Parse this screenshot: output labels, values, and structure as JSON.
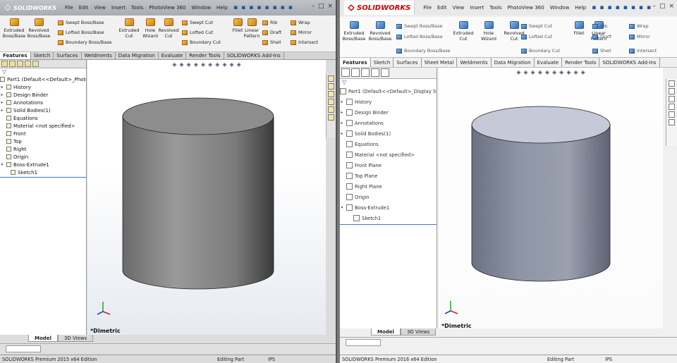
{
  "windows": [
    {
      "id": "w1",
      "logo": "SOLIDWORKS",
      "menu": [
        "File",
        "Edit",
        "View",
        "Insert",
        "Tools",
        "PhotoView 360",
        "Window",
        "Help"
      ],
      "ribbon_large": [
        [
          "Extruded",
          "Boss/Base"
        ],
        [
          "Revolved",
          "Boss/Base"
        ],
        [
          "Extruded",
          "Cut"
        ],
        [
          "Hole",
          "Wizard"
        ],
        [
          "Revolved",
          "Cut"
        ],
        [
          "Fillet",
          ""
        ],
        [
          "Linear",
          "Pattern"
        ]
      ],
      "ribbon_small": [
        "Swept Boss/Base",
        "Lofted Boss/Base",
        "Boundary Boss/Base",
        "Swept Cut",
        "Lofted Cut",
        "Boundary Cut",
        "Rib",
        "Draft",
        "Shell",
        "Wrap",
        "Mirror",
        "Intersect"
      ],
      "tabs": [
        "Features",
        "Sketch",
        "Surfaces",
        "Weldments",
        "Data Migration",
        "Evaluate",
        "Render Tools",
        "SOLIDWORKS Add-Ins"
      ],
      "tree": [
        "Part1  (Default<<Default>_Photo",
        "History",
        "Design Binder",
        "Annotations",
        "Solid Bodies(1)",
        "Equations",
        "Material <not specified>",
        "Front",
        "Top",
        "Right",
        "Origin",
        "Boss-Extrude1",
        "Sketch1"
      ],
      "bottom_tabs": [
        "Model",
        "3D Views"
      ],
      "orientation": "*Dimetric",
      "status": [
        "SOLIDWORKS Premium 2015 x64 Edition",
        "Editing Part",
        "IPS"
      ]
    },
    {
      "id": "w2",
      "logo": "SOLIDWORKS",
      "menu": [
        "File",
        "Edit",
        "View",
        "Insert",
        "Tools",
        "PhotoView 360",
        "Window",
        "Help"
      ],
      "ribbon_large": [
        [
          "Extruded",
          "Boss/Base"
        ],
        [
          "Revolved",
          "Boss/Base"
        ],
        [
          "Extruded",
          "Cut"
        ],
        [
          "Hole",
          "Wizard"
        ],
        [
          "Revolved",
          "Cut"
        ],
        [
          "Fillet",
          ""
        ],
        [
          "Linear",
          "Pattern"
        ]
      ],
      "ribbon_small": [
        "Swept Boss/Base",
        "Lofted Boss/Base",
        "Boundary Boss/Base",
        "Swept Cut",
        "Lofted Cut",
        "Boundary Cut",
        "Rib",
        "Draft",
        "Shell",
        "Wrap",
        "Mirror",
        "Intersect"
      ],
      "tabs": [
        "Features",
        "Sketch",
        "Surfaces",
        "Sheet Metal",
        "Weldments",
        "Data Migration",
        "Evaluate",
        "Render Tools",
        "SOLIDWORKS Add-Ins"
      ],
      "tree": [
        "Part1  (Default<<Default>_Display St",
        "History",
        "Design Binder",
        "Annotations",
        "Solid Bodies(1)",
        "Equations",
        "Material <not specified>",
        "Front Plane",
        "Top Plane",
        "Right Plane",
        "Origin",
        "Boss-Extrude1",
        "Sketch1"
      ],
      "bottom_tabs": [
        "Model",
        "3D Views"
      ],
      "orientation": "*Dimetric",
      "status": [
        "SOLIDWORKS Premium 2016 x64 Edition",
        "Editing Part",
        "IPS"
      ]
    }
  ],
  "colors": {
    "cylinder_2015": "#8c8c8c",
    "cylinder_2016": "#7e8594",
    "logo_red": "#cc0000"
  }
}
